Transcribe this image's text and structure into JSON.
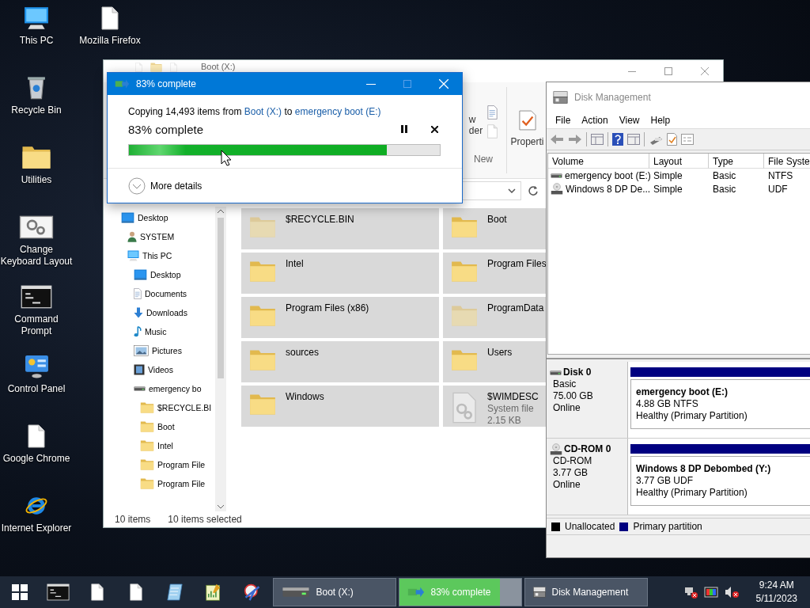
{
  "desktop_icons": [
    {
      "label": "This PC",
      "kind": "pc"
    },
    {
      "label": "Mozilla Firefox",
      "kind": "file"
    },
    {
      "label": "Recycle Bin",
      "kind": "bin"
    },
    {
      "label": "Utilities",
      "kind": "folder"
    },
    {
      "label": "Change Keyboard Layout",
      "kind": "settings"
    },
    {
      "label": "Command Prompt",
      "kind": "terminal"
    },
    {
      "label": "Control Panel",
      "kind": "control"
    },
    {
      "label": "Google Chrome",
      "kind": "file"
    },
    {
      "label": "Internet Explorer",
      "kind": "browser"
    }
  ],
  "explorer": {
    "title": "Boot (X:)",
    "ribbon": {
      "new_folder_label": [
        "w",
        "der"
      ],
      "group_label": "New",
      "properties_label": "Properti"
    },
    "nav_pane": [
      {
        "label": "Desktop",
        "kind": "desktop",
        "children": [
          {
            "label": "SYSTEM",
            "kind": "user"
          },
          {
            "label": "This PC",
            "kind": "pc",
            "children": [
              {
                "label": "Desktop",
                "kind": "desktop"
              },
              {
                "label": "Documents",
                "kind": "docs"
              },
              {
                "label": "Downloads",
                "kind": "download"
              },
              {
                "label": "Music",
                "kind": "music"
              },
              {
                "label": "Pictures",
                "kind": "pictures"
              },
              {
                "label": "Videos",
                "kind": "videos"
              },
              {
                "label": "emergency bo",
                "kind": "drive",
                "children": [
                  {
                    "label": "$RECYCLE.BI",
                    "kind": "folder"
                  },
                  {
                    "label": "Boot",
                    "kind": "folder"
                  },
                  {
                    "label": "Intel",
                    "kind": "folder"
                  },
                  {
                    "label": "Program File",
                    "kind": "folder"
                  },
                  {
                    "label": "Program File",
                    "kind": "folder"
                  }
                ]
              }
            ]
          }
        ]
      }
    ],
    "items": [
      {
        "name": "$RECYCLE.BIN",
        "kind": "folder",
        "hidden": true,
        "selected": true
      },
      {
        "name": "Boot",
        "kind": "folder",
        "hidden": false,
        "selected": true
      },
      {
        "name": "Intel",
        "kind": "folder",
        "hidden": false,
        "selected": true
      },
      {
        "name": "Program Files",
        "kind": "folder",
        "hidden": false,
        "selected": true
      },
      {
        "name": "Program Files (x86)",
        "kind": "folder",
        "hidden": false,
        "selected": true
      },
      {
        "name": "ProgramData",
        "kind": "folder",
        "hidden": true,
        "selected": true
      },
      {
        "name": "sources",
        "kind": "folder",
        "hidden": false,
        "selected": true
      },
      {
        "name": "Users",
        "kind": "folder",
        "hidden": false,
        "selected": true
      },
      {
        "name": "Windows",
        "kind": "folder",
        "hidden": false,
        "selected": true
      },
      {
        "name": "$WIMDESC",
        "kind": "file",
        "hidden": true,
        "selected": true,
        "details": [
          "System file",
          "2.15 KB"
        ]
      }
    ],
    "status_bar": {
      "count": "10 items",
      "selection": "10 items selected"
    }
  },
  "copy_dialog": {
    "title": "83% complete",
    "message": [
      {
        "kind": "text",
        "text": "Copying 14,493 items from"
      },
      {
        "kind": "link",
        "text": "Boot (X:)"
      },
      {
        "kind": "text",
        "text": "to"
      },
      {
        "kind": "link",
        "text": "emergency boot (E:)"
      }
    ],
    "heading": "83% complete",
    "level": 0.83,
    "more_details": "More details"
  },
  "disk_management": {
    "title": "Disk Management",
    "menu": [
      "File",
      "Action",
      "View",
      "Help"
    ],
    "columns": [
      "Volume",
      "Layout",
      "Type",
      "File Syste"
    ],
    "volumes": [
      {
        "kind": "disk",
        "cells": [
          "emergency boot (E:)",
          "Simple",
          "Basic",
          "NTFS"
        ]
      },
      {
        "kind": "cd",
        "cells": [
          "Windows 8 DP De...",
          "Simple",
          "Basic",
          "UDF"
        ]
      }
    ],
    "disks": [
      {
        "kind": "disk",
        "name": "Disk 0",
        "lines": [
          "Basic",
          "75.00 GB",
          "Online"
        ],
        "partition": {
          "name": "emergency boot  (E:)",
          "lines": [
            "4.88 GB NTFS",
            "Healthy (Primary Partition)"
          ]
        }
      },
      {
        "kind": "cd",
        "name": "CD-ROM 0",
        "lines": [
          "CD-ROM",
          "3.77 GB",
          "Online"
        ],
        "partition": {
          "name": "Windows 8 DP Debombed  (Y:)",
          "lines": [
            "3.77 GB UDF",
            "Healthy (Primary Partition)"
          ]
        }
      }
    ],
    "legend": [
      {
        "label": "Unallocated",
        "color": "#000000"
      },
      {
        "label": "Primary partition",
        "color": "#000080"
      }
    ]
  },
  "taskbar": {
    "pinned": [
      {
        "kind": "terminal"
      },
      {
        "kind": "file"
      },
      {
        "kind": "file"
      },
      {
        "kind": "notepad"
      },
      {
        "kind": "chartpad"
      },
      {
        "kind": "tool"
      }
    ],
    "tasks": [
      {
        "label": "Boot (X:)",
        "kind": "drive"
      },
      {
        "label": "83% complete",
        "kind": "copy",
        "level": 0.83
      },
      {
        "label": "Disk Management",
        "kind": "disk"
      }
    ],
    "time": "9:24 AM",
    "date": "5/11/2023"
  }
}
